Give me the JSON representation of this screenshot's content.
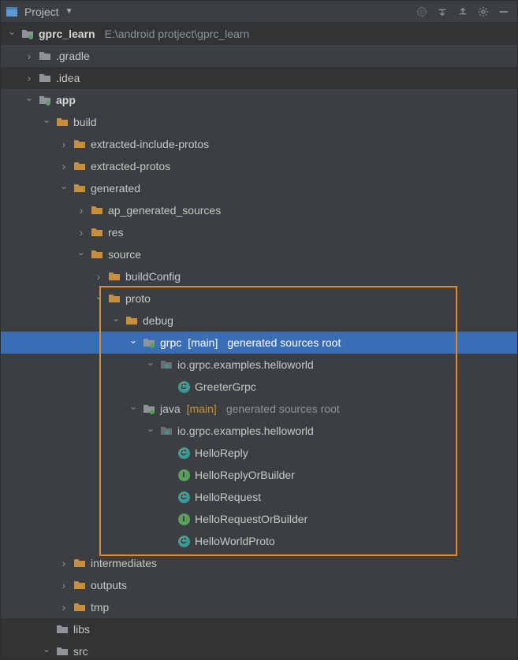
{
  "toolbar": {
    "title": "Project"
  },
  "root": {
    "name": "gprc_learn",
    "path": "E:\\android protject\\gprc_learn"
  },
  "rows": [
    {
      "label": ".gradle"
    },
    {
      "label": ".idea"
    },
    {
      "label": "app"
    },
    {
      "label": "build"
    },
    {
      "label": "extracted-include-protos"
    },
    {
      "label": "extracted-protos"
    },
    {
      "label": "generated"
    },
    {
      "label": "ap_generated_sources"
    },
    {
      "label": "res"
    },
    {
      "label": "source"
    },
    {
      "label": "buildConfig"
    },
    {
      "label": "proto"
    },
    {
      "label": "debug"
    },
    {
      "label": "grpc",
      "bracket": "[main]",
      "hint": "generated sources root"
    },
    {
      "label": "io.grpc.examples.helloworld"
    },
    {
      "label": "GreeterGrpc"
    },
    {
      "label": "java",
      "bracket": "[main]",
      "hint": "generated sources root"
    },
    {
      "label": "io.grpc.examples.helloworld"
    },
    {
      "label": "HelloReply"
    },
    {
      "label": "HelloReplyOrBuilder"
    },
    {
      "label": "HelloRequest"
    },
    {
      "label": "HelloRequestOrBuilder"
    },
    {
      "label": "HelloWorldProto"
    },
    {
      "label": "intermediates"
    },
    {
      "label": "outputs"
    },
    {
      "label": "tmp"
    },
    {
      "label": "libs"
    },
    {
      "label": "src"
    }
  ]
}
